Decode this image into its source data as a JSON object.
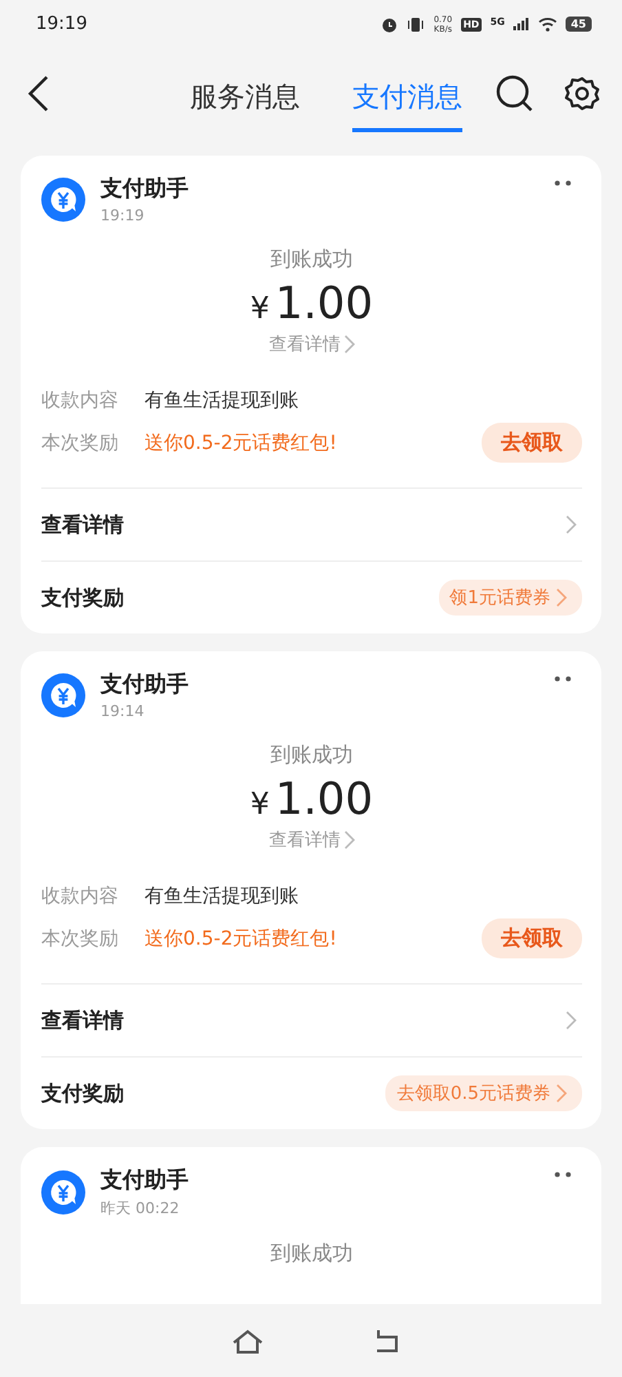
{
  "status_bar": {
    "time": "19:19",
    "speed": "0.70",
    "speed_unit": "KB/s",
    "hd": "HD",
    "network": "5G",
    "battery": "45"
  },
  "header": {
    "tabs": [
      {
        "label": "服务消息",
        "selected": false
      },
      {
        "label": "支付消息",
        "selected": true
      }
    ]
  },
  "messages": [
    {
      "sender": "支付助手",
      "time": "19:19",
      "status": "到账成功",
      "currency": "¥",
      "amount": "1.00",
      "details_link": "查看详情",
      "fields": [
        {
          "kind": "text",
          "label": "收款内容",
          "value": "有鱼生活提现到账"
        },
        {
          "kind": "reward",
          "label": "本次奖励",
          "value": "送你0.5-2元话费红包!",
          "action": "去领取"
        }
      ],
      "rows": [
        {
          "label": "查看详情"
        },
        {
          "label": "支付奖励",
          "tag": "领1元话费券"
        }
      ]
    },
    {
      "sender": "支付助手",
      "time": "19:14",
      "status": "到账成功",
      "currency": "¥",
      "amount": "1.00",
      "details_link": "查看详情",
      "fields": [
        {
          "kind": "text",
          "label": "收款内容",
          "value": "有鱼生活提现到账"
        },
        {
          "kind": "reward",
          "label": "本次奖励",
          "value": "送你0.5-2元话费红包!",
          "action": "去领取"
        }
      ],
      "rows": [
        {
          "label": "查看详情"
        },
        {
          "label": "支付奖励",
          "tag": "去领取0.5元话费券"
        }
      ]
    },
    {
      "sender": "支付助手",
      "time": "昨天 00:22",
      "status": "到账成功"
    }
  ]
}
